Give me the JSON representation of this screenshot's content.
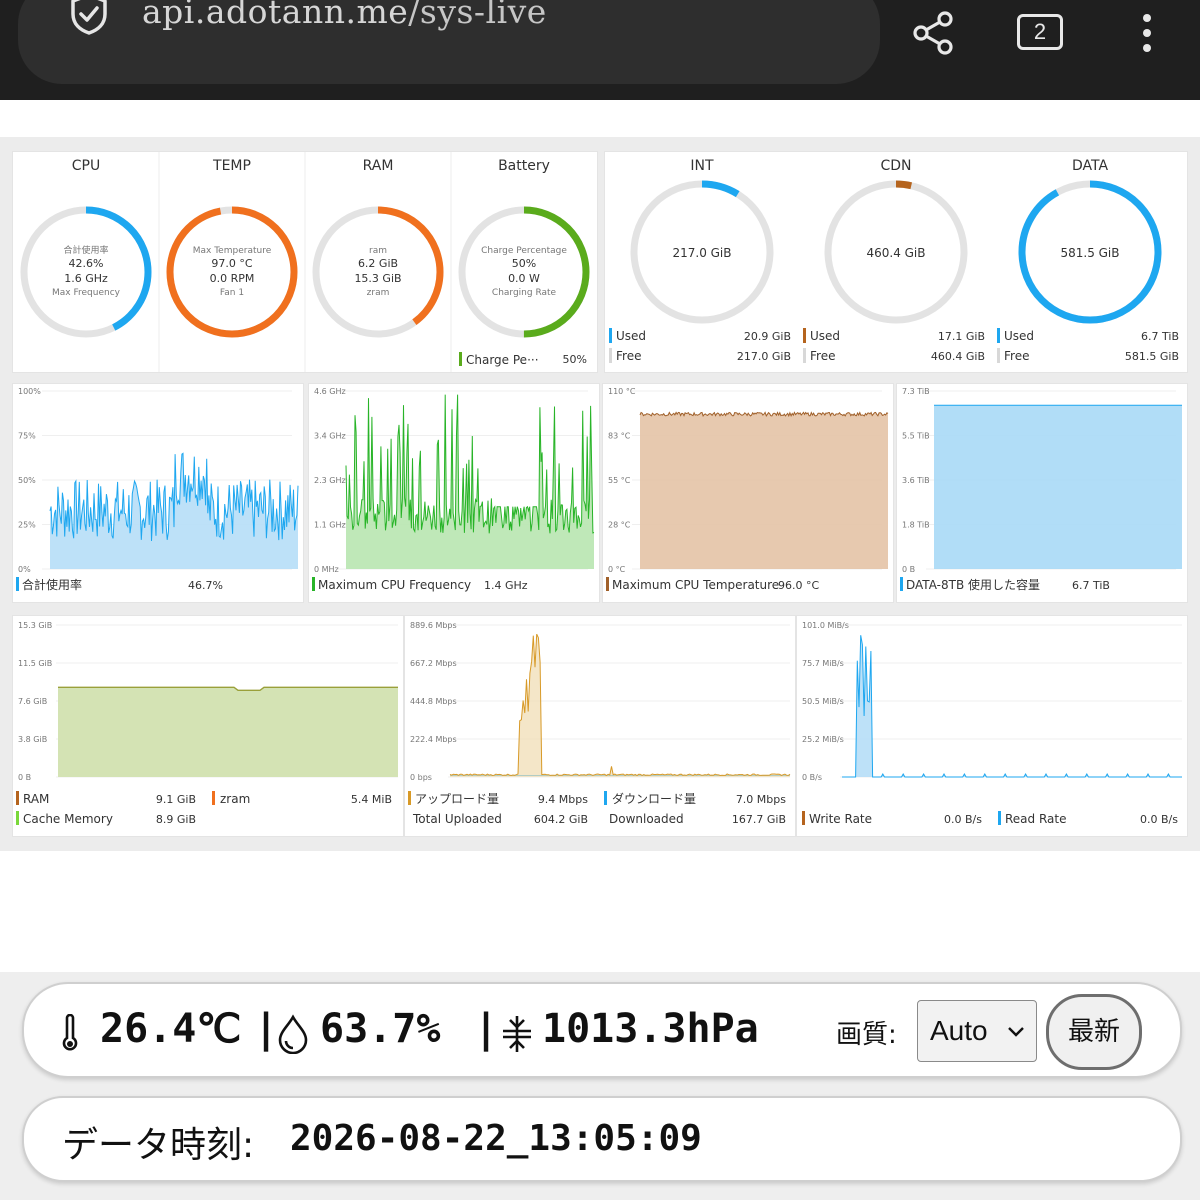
{
  "browser": {
    "url_host": "api.adotann.me",
    "url_path": "/sys-live",
    "tab_count": "2"
  },
  "gauges_left": [
    {
      "title": "CPU",
      "lines": [
        "合計使用率",
        "42.6%",
        "1.6 GHz",
        "Max Frequency"
      ],
      "percent": 42.6,
      "color": "#1ea7f0"
    },
    {
      "title": "TEMP",
      "lines": [
        "Max Temperature",
        "97.0 °C",
        "0.0 RPM",
        "Fan 1"
      ],
      "percent": 97,
      "color": "#f0701e"
    },
    {
      "title": "RAM",
      "lines": [
        "ram",
        "6.2 GiB",
        "15.3 GiB",
        "zram"
      ],
      "percent": 40,
      "color": "#f0701e"
    },
    {
      "title": "Battery",
      "lines": [
        "Charge Percentage",
        "50%",
        "0.0 W",
        "Charging Rate"
      ],
      "percent": 50,
      "color": "#5aab1c"
    }
  ],
  "battery_legend": {
    "label": "Charge Pe···",
    "value": "50%",
    "color": "#5aab1c"
  },
  "gauges_disk": [
    {
      "title": "INT",
      "center": "217.0 GiB",
      "percent": 8.8,
      "color": "#1ea7f0",
      "legend": [
        {
          "label": "Used",
          "value": "20.9 GiB",
          "color": "#1ea7f0"
        },
        {
          "label": "Free",
          "value": "217.0 GiB",
          "color": "#d8d8d8"
        }
      ]
    },
    {
      "title": "CDN",
      "center": "460.4 GiB",
      "percent": 3.6,
      "color": "#b5641e",
      "legend": [
        {
          "label": "Used",
          "value": "17.1 GiB",
          "color": "#b5641e"
        },
        {
          "label": "Free",
          "value": "460.4 GiB",
          "color": "#d8d8d8"
        }
      ]
    },
    {
      "title": "DATA",
      "center": "581.5 GiB",
      "percent": 92,
      "color": "#1ea7f0",
      "legend": [
        {
          "label": "Used",
          "value": "6.7 TiB",
          "color": "#1ea7f0"
        },
        {
          "label": "Free",
          "value": "581.5 GiB",
          "color": "#d8d8d8"
        }
      ]
    }
  ],
  "charts_row1": [
    {
      "yticks": [
        "100%",
        "75%",
        "50%",
        "25%",
        "0%"
      ],
      "legend": "合計使用率",
      "value": "46.7%",
      "color": "#1ea7f0",
      "fill": "#b6def7",
      "style": "noise",
      "level": 0.33
    },
    {
      "yticks": [
        "4.6 GHz",
        "3.4 GHz",
        "2.3 GHz",
        "1.1 GHz",
        "0 MHz"
      ],
      "legend": "Maximum CPU Frequency",
      "value": "1.4 GHz",
      "color": "#28b428",
      "fill": "#b8e6b0",
      "style": "spiky",
      "level": 0.3
    },
    {
      "yticks": [
        "110 °C",
        "83 °C",
        "55 °C",
        "28 °C",
        "0 °C"
      ],
      "legend": "Maximum CPU Temperature",
      "value": "96.0 °C",
      "color": "#a0602a",
      "fill": "#e4c3a6",
      "style": "flat",
      "level": 0.87
    },
    {
      "yticks": [
        "7.3 TiB",
        "5.5 TiB",
        "3.6 TiB",
        "1.8 TiB",
        "0 B"
      ],
      "legend": "DATA-8TB 使用した容量",
      "value": "6.7 TiB",
      "color": "#1ea7f0",
      "fill": "#a9d9f6",
      "style": "full",
      "level": 0.92
    }
  ],
  "charts_row2": [
    {
      "yticks": [
        "15.3 GiB",
        "11.5 GiB",
        "7.6 GiB",
        "3.8 GiB",
        "0 B"
      ],
      "legend": [
        {
          "label": "RAM",
          "value": "9.1 GiB",
          "color": "#b5641e"
        },
        {
          "label": "zram",
          "value": "5.4 MiB",
          "color": "#f0701e"
        },
        {
          "label": "Cache Memory",
          "value": "8.9 GiB",
          "color": "#7ad83a"
        }
      ]
    },
    {
      "yticks": [
        "889.6 Mbps",
        "667.2 Mbps",
        "444.8 Mbps",
        "222.4 Mbps",
        "0 bps"
      ],
      "legend": [
        {
          "label": "アップロード量",
          "value": "9.4 Mbps",
          "color": "#d89a28"
        },
        {
          "label": "ダウンロード量",
          "value": "7.0 Mbps",
          "color": "#1ea7f0"
        },
        {
          "label": "Total Uploaded",
          "value": "604.2 GiB",
          "color": ""
        },
        {
          "label": "Downloaded",
          "value": "167.7 GiB",
          "color": ""
        }
      ]
    },
    {
      "yticks": [
        "101.0 MiB/s",
        "75.7 MiB/s",
        "50.5 MiB/s",
        "25.2 MiB/s",
        "0 B/s"
      ],
      "legend": [
        {
          "label": "Write Rate",
          "value": "0.0 B/s",
          "color": "#b5641e"
        },
        {
          "label": "Read Rate",
          "value": "0.0 B/s",
          "color": "#1ea7f0"
        }
      ]
    }
  ],
  "sensors": {
    "temperature": "26.4℃",
    "humidity": "63.7%",
    "pressure": "1013.3hPa",
    "separator": "|",
    "quality_label": "画質:",
    "quality_value": "Auto",
    "reload_label": "最新"
  },
  "timestamp": {
    "label": "データ時刻:",
    "value": "2026-08-22_13:05:09"
  }
}
